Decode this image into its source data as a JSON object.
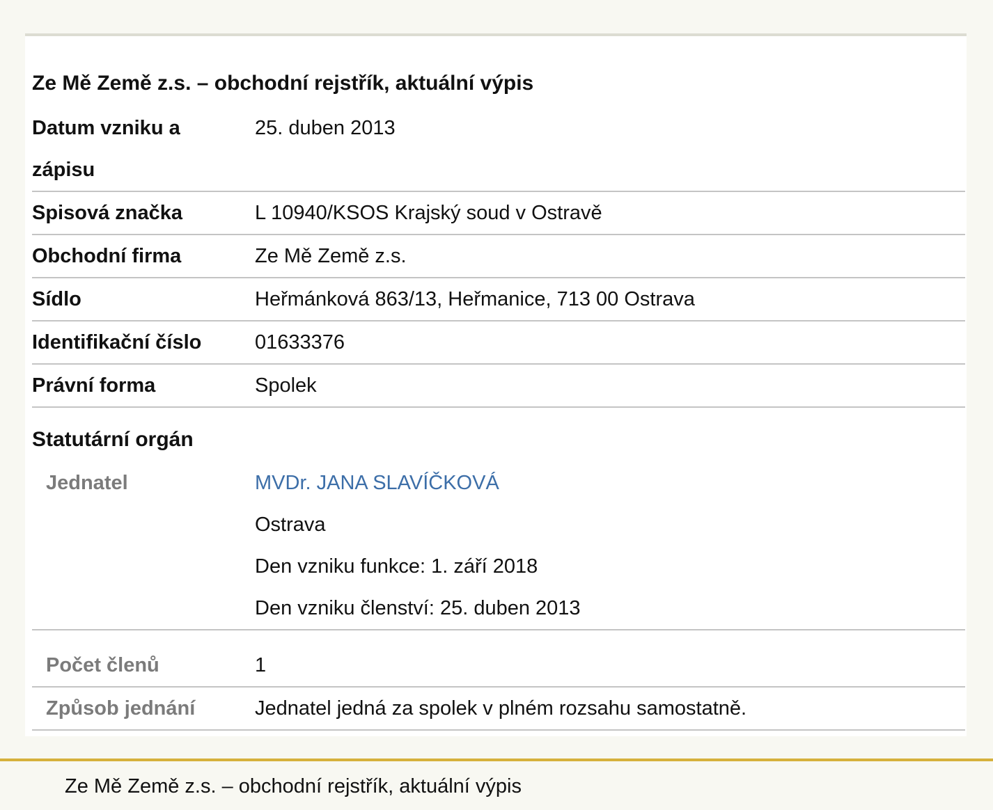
{
  "document": {
    "title": "Ze Mě Země z.s. – obchodní rejstřík, aktuální výpis"
  },
  "fields": {
    "datum_label": "Datum vzniku a zápisu",
    "datum_value": "25. duben 2013",
    "spisova_label": "Spisová značka",
    "spisova_value": "L 10940/KSOS Krajský soud v Ostravě",
    "firma_label": "Obchodní firma",
    "firma_value": "Ze Mě Země z.s.",
    "sidlo_label": "Sídlo",
    "sidlo_value": "Heřmánková 863/13, Heřmanice, 713 00 Ostrava",
    "ico_label": "Identifikační číslo",
    "ico_value": "01633376",
    "forma_label": "Právní forma",
    "forma_value": "Spolek"
  },
  "statutarni": {
    "heading": "Statutární orgán",
    "jednatel_label": "Jednatel",
    "jednatel_name": "MVDr. JANA SLAVÍČKOVÁ",
    "jednatel_city": "Ostrava",
    "jednatel_funkce": "Den vzniku funkce: 1. září 2018",
    "jednatel_clenstvi": "Den vzniku členství: 25. duben 2013",
    "pocet_label": "Počet členů",
    "pocet_value": "1",
    "zpusob_label": "Způsob jednání",
    "zpusob_value": "Jednatel jedná za spolek v plném rozsahu samostatně."
  },
  "footer": {
    "text": "Ze Mě Země z.s. – obchodní rejstřík, aktuální výpis"
  },
  "colors": {
    "link": "#3c6ea8",
    "footer_accent": "#d6b13c"
  }
}
